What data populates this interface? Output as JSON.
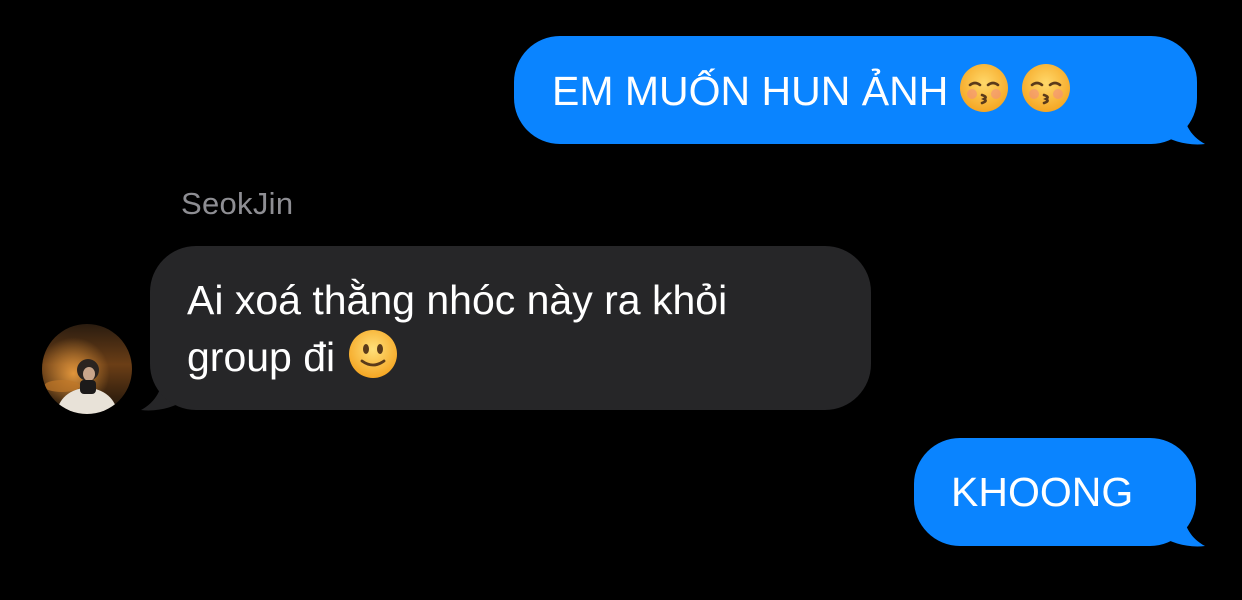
{
  "colors": {
    "background": "#000000",
    "outgoing_bubble": "#0a84ff",
    "incoming_bubble": "#262628",
    "sender_name": "#8e8e93",
    "text": "#ffffff"
  },
  "messages": [
    {
      "direction": "outgoing",
      "text": "EM MUỐN HUN ẢNH",
      "emojis": [
        "kissing-face-with-closed-eyes-icon",
        "kissing-face-with-closed-eyes-icon"
      ]
    },
    {
      "direction": "incoming",
      "sender": "SeokJin",
      "text": "Ai xoá thằng nhóc này ra khỏi group đi",
      "emojis": [
        "slightly-smiling-face-icon"
      ]
    },
    {
      "direction": "outgoing",
      "text": "KHOONG",
      "emojis": []
    }
  ]
}
